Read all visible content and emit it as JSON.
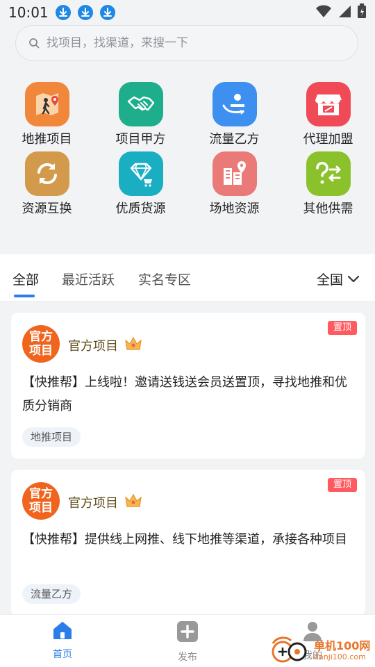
{
  "status_bar": {
    "time": "10:01"
  },
  "search": {
    "placeholder": "找项目，找渠道，来搜一下"
  },
  "categories": [
    {
      "label": "地推项目",
      "icon": "ground-promotion-icon",
      "color": "#f0873a"
    },
    {
      "label": "项目甲方",
      "icon": "handshake-icon",
      "color": "#1fae8c"
    },
    {
      "label": "流量乙方",
      "icon": "traffic-icon",
      "color": "#3d8ff0"
    },
    {
      "label": "代理加盟",
      "icon": "store-icon",
      "color": "#ef4a56"
    },
    {
      "label": "资源互换",
      "icon": "exchange-icon",
      "color": "#d39a4c"
    },
    {
      "label": "优质货源",
      "icon": "diamond-cart-icon",
      "color": "#1aaec3"
    },
    {
      "label": "场地资源",
      "icon": "venue-icon",
      "color": "#e97a78"
    },
    {
      "label": "其他供需",
      "icon": "question-exchange-icon",
      "color": "#8bc22c"
    }
  ],
  "tabs": [
    {
      "label": "全部"
    },
    {
      "label": "最近活跃"
    },
    {
      "label": "实名专区"
    }
  ],
  "region_selector": {
    "label": "全国"
  },
  "cards": [
    {
      "avatar_line1": "官方",
      "avatar_line2": "项目",
      "source": "官方项目",
      "badge": "置顶",
      "text": "【快推帮】上线啦！邀请送钱送会员送置顶，寻找地推和优质分销商",
      "tag": "地推项目"
    },
    {
      "avatar_line1": "官方",
      "avatar_line2": "项目",
      "source": "官方项目",
      "badge": "置顶",
      "text": "【快推帮】提供线上网推、线下地推等渠道，承接各种项目",
      "tag": "流量乙方"
    }
  ],
  "bottom_nav": [
    {
      "label": "首页"
    },
    {
      "label": "发布"
    },
    {
      "label": "我的"
    }
  ],
  "watermark": {
    "cn": "单机100网",
    "en": "danji100.com"
  },
  "colors": {
    "accent": "#2b7de9",
    "badge": "#ff5a5f",
    "avatar": "#f0641e"
  }
}
